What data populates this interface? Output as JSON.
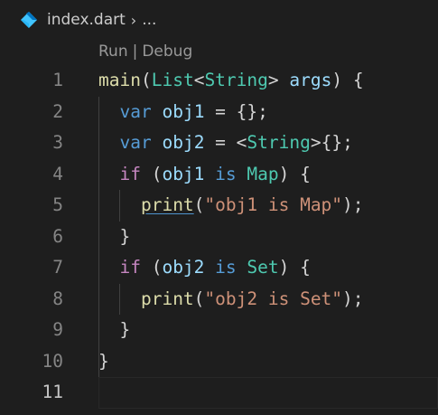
{
  "breadcrumb": {
    "icon": "dart-icon",
    "file": "index.dart",
    "separator": "›",
    "more": "..."
  },
  "codelens": {
    "run": "Run",
    "separator": "|",
    "debug": "Debug"
  },
  "colors": {
    "background": "#1e1e1e",
    "function": "#dcdcaa",
    "type": "#4ec9b0",
    "variable": "#9cdcfe",
    "keyword": "#569cd6",
    "control": "#c586c0",
    "string": "#ce9178",
    "line_number": "#858585"
  },
  "editor": {
    "active_line": 11,
    "lines": [
      {
        "number": "1",
        "tokens": [
          [
            "fn",
            "main"
          ],
          [
            "pun",
            "("
          ],
          [
            "type",
            "List"
          ],
          [
            "pun",
            "<"
          ],
          [
            "type",
            "String"
          ],
          [
            "pun",
            "> "
          ],
          [
            "var",
            "args"
          ],
          [
            "pun",
            ") {"
          ]
        ]
      },
      {
        "number": "2",
        "tokens": [
          [
            "pun",
            "  "
          ],
          [
            "kw",
            "var"
          ],
          [
            "pun",
            " "
          ],
          [
            "var",
            "obj1"
          ],
          [
            "pun",
            " = {};"
          ]
        ]
      },
      {
        "number": "3",
        "tokens": [
          [
            "pun",
            "  "
          ],
          [
            "kw",
            "var"
          ],
          [
            "pun",
            " "
          ],
          [
            "var",
            "obj2"
          ],
          [
            "pun",
            " = <"
          ],
          [
            "type",
            "String"
          ],
          [
            "pun",
            ">{};"
          ]
        ]
      },
      {
        "number": "4",
        "tokens": [
          [
            "pun",
            "  "
          ],
          [
            "ctl",
            "if"
          ],
          [
            "pun",
            " ("
          ],
          [
            "var",
            "obj1"
          ],
          [
            "pun",
            " "
          ],
          [
            "kw",
            "is"
          ],
          [
            "pun",
            " "
          ],
          [
            "type",
            "Map"
          ],
          [
            "pun",
            ") {"
          ]
        ]
      },
      {
        "number": "5",
        "tokens": [
          [
            "pun",
            "    "
          ],
          [
            "link",
            "print"
          ],
          [
            "pun",
            "("
          ],
          [
            "str",
            "\"obj1 is Map\""
          ],
          [
            "pun",
            ");"
          ]
        ]
      },
      {
        "number": "6",
        "tokens": [
          [
            "pun",
            "  }"
          ]
        ]
      },
      {
        "number": "7",
        "tokens": [
          [
            "pun",
            "  "
          ],
          [
            "ctl",
            "if"
          ],
          [
            "pun",
            " ("
          ],
          [
            "var",
            "obj2"
          ],
          [
            "pun",
            " "
          ],
          [
            "kw",
            "is"
          ],
          [
            "pun",
            " "
          ],
          [
            "type",
            "Set"
          ],
          [
            "pun",
            ") {"
          ]
        ]
      },
      {
        "number": "8",
        "tokens": [
          [
            "pun",
            "    "
          ],
          [
            "fn",
            "print"
          ],
          [
            "pun",
            "("
          ],
          [
            "str",
            "\"obj2 is Set\""
          ],
          [
            "pun",
            ");"
          ]
        ]
      },
      {
        "number": "9",
        "tokens": [
          [
            "pun",
            "  }"
          ]
        ]
      },
      {
        "number": "10",
        "tokens": [
          [
            "pun",
            "}"
          ]
        ]
      },
      {
        "number": "11",
        "tokens": []
      }
    ]
  }
}
